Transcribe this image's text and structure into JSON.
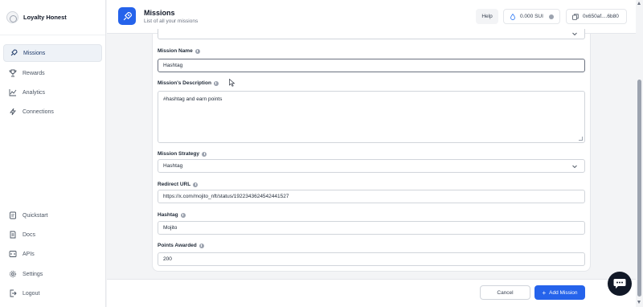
{
  "brand": {
    "name": "Loyalty Honest"
  },
  "sidebar": {
    "top_items": [
      {
        "label": "Missions",
        "icon": "rocket-icon",
        "active": true
      },
      {
        "label": "Rewards",
        "icon": "trophy-icon"
      },
      {
        "label": "Analytics",
        "icon": "chart-line-icon"
      },
      {
        "label": "Connections",
        "icon": "lightning-icon"
      }
    ],
    "bottom_items": [
      {
        "label": "Quickstart",
        "icon": "quickstart-icon"
      },
      {
        "label": "Docs",
        "icon": "docs-icon"
      },
      {
        "label": "APIs",
        "icon": "code-icon"
      },
      {
        "label": "Settings",
        "icon": "gear-icon"
      },
      {
        "label": "Logout",
        "icon": "logout-icon"
      }
    ]
  },
  "header": {
    "title": "Missions",
    "subtitle": "List of all your missions",
    "help_label": "Help",
    "balance": "0.000 SUI",
    "address": "0x650af....6b80"
  },
  "form": {
    "name_label": "Mission Name",
    "name_value": "Hashtag",
    "description_label": "Mission's Description",
    "description_value": "#hashtag and earn points",
    "strategy_label": "Mission Strategy",
    "strategy_value": "Hashtag",
    "redirect_label": "Redirect URL",
    "redirect_value": "https://x.com/mojito_nft/status/1922343624542441527",
    "hashtag_label": "Hashtag",
    "hashtag_value": "Mojito",
    "points_label": "Points Awarded",
    "points_value": "200"
  },
  "footer": {
    "cancel_label": "Cancel",
    "add_label": "Add Mission"
  },
  "colors": {
    "accent": "#2563eb",
    "sidebar_active_bg": "#eef2f7",
    "page_bg": "#f3f4f6"
  }
}
